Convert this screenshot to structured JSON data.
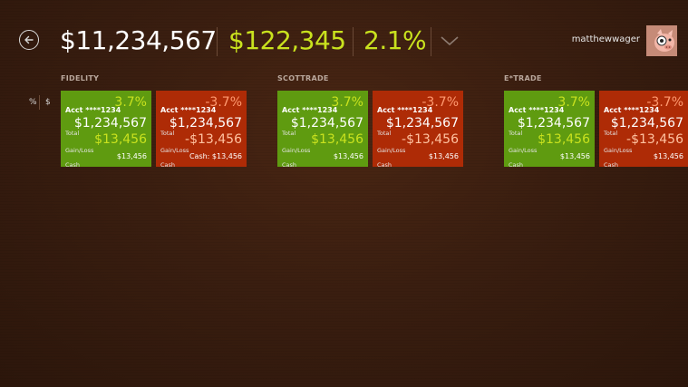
{
  "header": {
    "back_icon": "back-arrow-icon",
    "total": "$11,234,567",
    "gain": "$122,345",
    "percent": "2.1%",
    "expand_icon": "chevron-down-icon",
    "username": "matthewwager",
    "avatar_icon": "pig-avatar"
  },
  "toggle": {
    "percent_label": "%",
    "dollar_label": "$"
  },
  "colors": {
    "positive_tile": "#5f9b10",
    "negative_tile": "#ae2b06",
    "positive_text": "#c9e21e",
    "negative_text": "#ff9a70"
  },
  "brokers": [
    {
      "name": "FIDELITY",
      "accounts": [
        {
          "acct": "Acct ****1234",
          "pct": "3.7%",
          "total_label": "Total",
          "total": "$1,234,567",
          "gl_label": "Gain/Loss",
          "gl": "$13,456",
          "cash_label": "Cash",
          "cash": "$13,456"
        },
        {
          "acct": "Acct ****1234",
          "pct": "-3.7%",
          "total_label": "Total",
          "total": "$1,234,567",
          "gl_label": "Gain/Loss",
          "gl": "-$13,456",
          "cash_label": "Cash",
          "cash": "Cash: $13,456"
        }
      ]
    },
    {
      "name": "SCOTTRADE",
      "accounts": [
        {
          "acct": "Acct ****1234",
          "pct": "3.7%",
          "total_label": "Total",
          "total": "$1,234,567",
          "gl_label": "Gain/Loss",
          "gl": "$13,456",
          "cash_label": "Cash",
          "cash": "$13,456"
        },
        {
          "acct": "Acct ****1234",
          "pct": "-3.7%",
          "total_label": "Total",
          "total": "$1,234,567",
          "gl_label": "Gain/Loss",
          "gl": "-$13,456",
          "cash_label": "Cash",
          "cash": "$13,456"
        }
      ]
    },
    {
      "name": "E*TRADE",
      "accounts": [
        {
          "acct": "Acct ****1234",
          "pct": "3.7%",
          "total_label": "Total",
          "total": "$1,234,567",
          "gl_label": "Gain/Loss",
          "gl": "$13,456",
          "cash_label": "Cash",
          "cash": "$13,456"
        },
        {
          "acct": "Acct ****1234",
          "pct": "-3.7%",
          "total_label": "Total",
          "total": "$1,234,567",
          "gl_label": "Gain/Loss",
          "gl": "-$13,456",
          "cash_label": "Cash",
          "cash": "$13,456"
        }
      ]
    }
  ]
}
